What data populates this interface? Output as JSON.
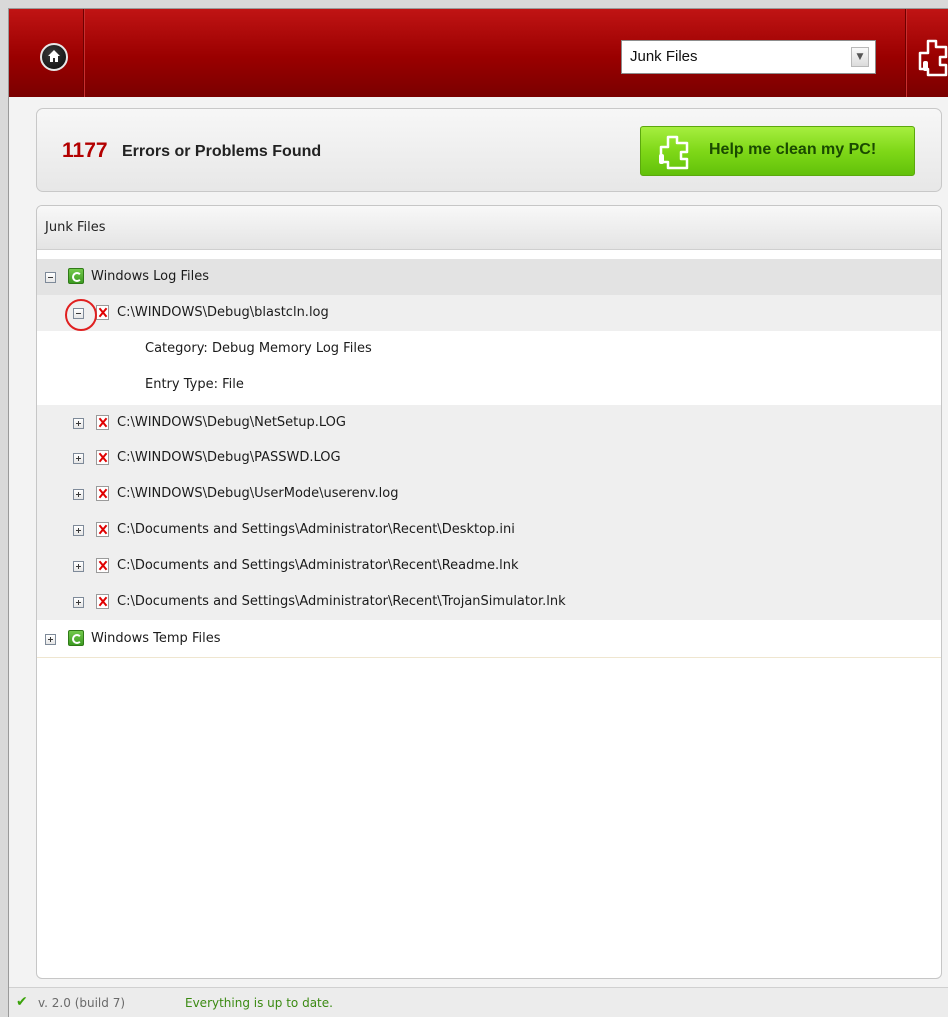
{
  "header": {
    "category_select_value": "Junk Files"
  },
  "summary": {
    "error_count": "1177",
    "error_text": "Errors or Problems Found",
    "clean_button_label": "Help me clean my PC!"
  },
  "tree": {
    "header_label": "Junk Files",
    "group_log": {
      "label": "Windows Log Files",
      "expanded": true
    },
    "item_expanded": {
      "path": "C:\\WINDOWS\\Debug\\blastcln.log",
      "category": "Category: Debug Memory Log Files",
      "entry_type": "Entry Type: File"
    },
    "items": [
      "C:\\WINDOWS\\Debug\\NetSetup.LOG",
      "C:\\WINDOWS\\Debug\\PASSWD.LOG",
      "C:\\WINDOWS\\Debug\\UserMode\\userenv.log",
      "C:\\Documents and Settings\\Administrator\\Recent\\Desktop.ini",
      "C:\\Documents and Settings\\Administrator\\Recent\\Readme.lnk",
      "C:\\Documents and Settings\\Administrator\\Recent\\TrojanSimulator.lnk"
    ],
    "group_temp": {
      "label": "Windows Temp Files",
      "expanded": false
    }
  },
  "status": {
    "version": "v. 2.0 (build 7)",
    "message": "Everything is up to date."
  },
  "icons": {
    "home": "home-icon",
    "puzzle": "puzzle-icon",
    "expand": "plus-box-icon",
    "collapse": "minus-box-icon",
    "recycle": "recycle-icon",
    "error_file": "red-x-file-icon",
    "check": "checkmark-icon"
  },
  "colors": {
    "header_red": "#a00000",
    "error_red": "#b30000",
    "clean_green": "#7fd818",
    "status_green": "#3b8a12"
  }
}
